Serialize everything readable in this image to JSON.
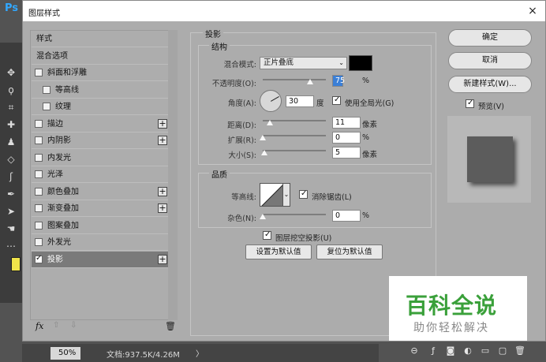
{
  "app": {
    "logo": "Ps"
  },
  "dialog": {
    "title": "图层样式",
    "close": "×"
  },
  "style_list": {
    "items": [
      {
        "label": "样式",
        "checkbox": false,
        "plus": false
      },
      {
        "label": "混合选项",
        "checkbox": false,
        "plus": false
      },
      {
        "label": "斜面和浮雕",
        "checkbox": true,
        "checked": false,
        "plus": false
      },
      {
        "label": "等高线",
        "checkbox": true,
        "checked": false,
        "plus": false,
        "indent": true
      },
      {
        "label": "纹理",
        "checkbox": true,
        "checked": false,
        "plus": false,
        "indent": true
      },
      {
        "label": "描边",
        "checkbox": true,
        "checked": false,
        "plus": true
      },
      {
        "label": "内阴影",
        "checkbox": true,
        "checked": false,
        "plus": true
      },
      {
        "label": "内发光",
        "checkbox": true,
        "checked": false,
        "plus": false
      },
      {
        "label": "光泽",
        "checkbox": true,
        "checked": false,
        "plus": false
      },
      {
        "label": "颜色叠加",
        "checkbox": true,
        "checked": false,
        "plus": true
      },
      {
        "label": "渐变叠加",
        "checkbox": true,
        "checked": false,
        "plus": true
      },
      {
        "label": "图案叠加",
        "checkbox": true,
        "checked": false,
        "plus": false
      },
      {
        "label": "外发光",
        "checkbox": true,
        "checked": false,
        "plus": false
      },
      {
        "label": "投影",
        "checkbox": true,
        "checked": true,
        "plus": true,
        "active": true
      }
    ],
    "footer": {
      "fx": "fx",
      "up": "⇧",
      "down": "⇩",
      "trash": "🗑"
    }
  },
  "drop_shadow": {
    "section_title": "投影",
    "structure": {
      "title": "结构",
      "blend_mode_label": "混合模式:",
      "blend_mode_value": "正片叠底",
      "shadow_color": "#000000",
      "opacity_label": "不透明度(O):",
      "opacity_value": "75",
      "opacity_level": 75,
      "opacity_unit": "%",
      "angle_label": "角度(A):",
      "angle_value": "30",
      "angle_unit": "度",
      "global_light_label": "使用全局光(G)",
      "global_light_checked": true,
      "distance_label": "距离(D):",
      "distance_value": "11",
      "distance_unit": "像素",
      "spread_label": "扩展(R):",
      "spread_value": "0",
      "spread_unit": "%",
      "size_label": "大小(S):",
      "size_value": "5",
      "size_unit": "像素"
    },
    "quality": {
      "title": "品质",
      "contour_label": "等高线:",
      "anti_aliased_label": "消除锯齿(L)",
      "anti_aliased_checked": true,
      "noise_label": "杂色(N):",
      "noise_value": "0",
      "noise_unit": "%"
    },
    "knockout_label": "图层挖空投影(U)",
    "knockout_checked": true,
    "make_default_button": "设置为默认值",
    "reset_default_button": "复位为默认值"
  },
  "actions": {
    "ok": "确定",
    "cancel": "取消",
    "new_style": "新建样式(W)...",
    "preview_label": "预览(V)",
    "preview_checked": true
  },
  "status_bar": {
    "zoom": "50%",
    "doc_info": "文档:937.5K/4.26M",
    "arrow": "〉"
  },
  "watermark": {
    "title": "百科全说",
    "subtitle": "助你轻松解决"
  }
}
